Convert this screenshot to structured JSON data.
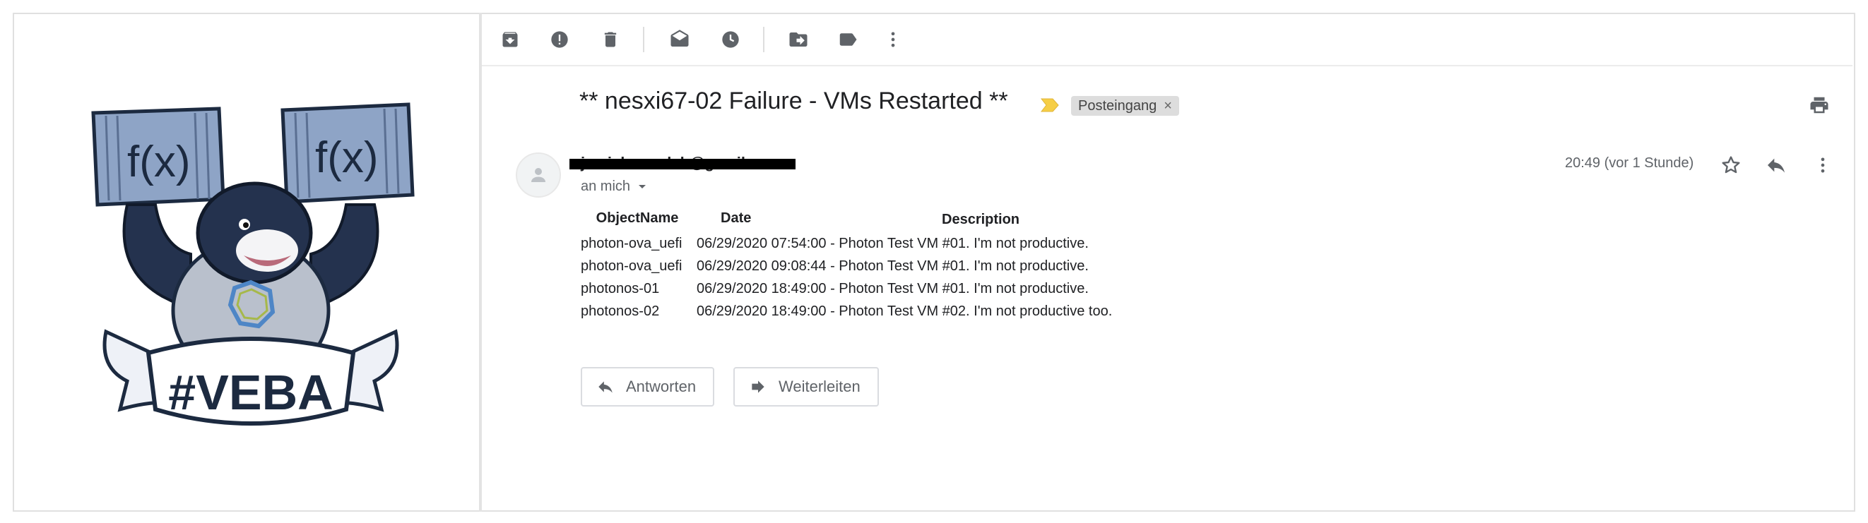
{
  "toolbar": {
    "icons": [
      "archive-icon",
      "report-spam-icon",
      "delete-icon",
      "mark-unread-icon",
      "snooze-icon",
      "move-to-icon",
      "label-icon",
      "more-vert-icon"
    ]
  },
  "email": {
    "subject": "** nesxi67-02 Failure - VMs Restarted **",
    "label": "Posteingang",
    "label_remove": "×",
    "sender": "jamieharmelsh@gmail.com",
    "recipient": "an mich",
    "time": "20:49 (vor 1 Stunde)",
    "table": {
      "headers": [
        "ObjectName",
        "Date",
        "Description"
      ],
      "rows": [
        [
          "photon-ova_uefi",
          "06/29/2020 07:54:00 - Photon Test VM #01. I'm not productive."
        ],
        [
          "photon-ova_uefi",
          "06/29/2020 09:08:44 - Photon Test VM #01. I'm not productive."
        ],
        [
          "photonos-01",
          "06/29/2020 18:49:00 - Photon Test VM #01. I'm not productive."
        ],
        [
          "photonos-02",
          "06/29/2020 18:49:00 - Photon Test VM #02. I'm not productive too."
        ]
      ]
    }
  },
  "actions": {
    "reply": "Antworten",
    "forward": "Weiterleiten"
  },
  "logo": {
    "text": "#VEBA",
    "box_text": "f(x)"
  },
  "colors": {
    "important_marker": "#f6ce46",
    "redaction": "#000000",
    "icon_gray": "#5f6368"
  }
}
